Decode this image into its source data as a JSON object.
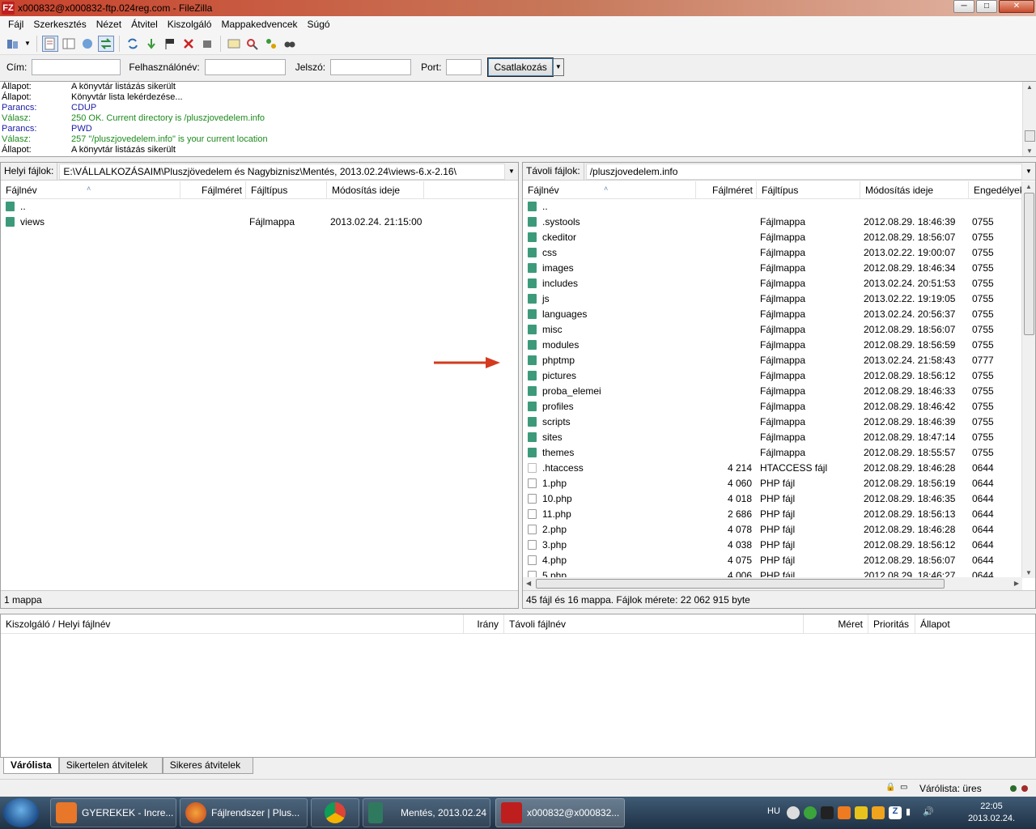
{
  "window": {
    "title": "x000832@x000832-ftp.024reg.com - FileZilla",
    "app_icon": "FZ"
  },
  "menu": [
    "Fájl",
    "Szerkesztés",
    "Nézet",
    "Átvitel",
    "Kiszolgáló",
    "Mappakedvencek",
    "Súgó"
  ],
  "quickconnect": {
    "host_label": "Cím:",
    "user_label": "Felhasználónév:",
    "pass_label": "Jelszó:",
    "port_label": "Port:",
    "host_value": "",
    "user_value": "",
    "pass_value": "",
    "port_value": "",
    "connect_label": "Csatlakozás"
  },
  "log": [
    {
      "kind": "status",
      "k": "Állapot:",
      "v": "A könyvtár listázás sikerült"
    },
    {
      "kind": "status",
      "k": "Állapot:",
      "v": "Könyvtár lista lekérdezése..."
    },
    {
      "kind": "cmd",
      "k": "Parancs:",
      "v": "CDUP"
    },
    {
      "kind": "resp",
      "k": "Válasz:",
      "v": "250 OK. Current directory is /pluszjovedelem.info"
    },
    {
      "kind": "cmd",
      "k": "Parancs:",
      "v": "PWD"
    },
    {
      "kind": "resp",
      "k": "Válasz:",
      "v": "257 \"/pluszjovedelem.info\" is your current location"
    },
    {
      "kind": "status",
      "k": "Állapot:",
      "v": "A könyvtár listázás sikerült"
    }
  ],
  "local": {
    "label": "Helyi fájlok:",
    "path": "E:\\VÁLLALKOZÁSAIM\\Pluszjövedelem és Nagybiznisz\\Mentés, 2013.02.24\\views-6.x-2.16\\",
    "headers": {
      "name": "Fájlnév",
      "size": "Fájlméret",
      "type": "Fájltípus",
      "modified": "Módosítás ideje"
    },
    "rows": [
      {
        "name": "..",
        "size": "",
        "type": "",
        "modified": "",
        "icon": "folder"
      },
      {
        "name": "views",
        "size": "",
        "type": "Fájlmappa",
        "modified": "2013.02.24. 21:15:00",
        "icon": "folder"
      }
    ],
    "status": "1 mappa"
  },
  "remote": {
    "label": "Távoli fájlok:",
    "path": "/pluszjovedelem.info",
    "headers": {
      "name": "Fájlnév",
      "size": "Fájlméret",
      "type": "Fájltípus",
      "modified": "Módosítás ideje",
      "perms": "Engedélyek"
    },
    "rows": [
      {
        "name": "..",
        "size": "",
        "type": "",
        "modified": "",
        "perms": "",
        "icon": "folder"
      },
      {
        "name": ".systools",
        "size": "",
        "type": "Fájlmappa",
        "modified": "2012.08.29. 18:46:39",
        "perms": "0755",
        "icon": "folder"
      },
      {
        "name": "ckeditor",
        "size": "",
        "type": "Fájlmappa",
        "modified": "2012.08.29. 18:56:07",
        "perms": "0755",
        "icon": "folder"
      },
      {
        "name": "css",
        "size": "",
        "type": "Fájlmappa",
        "modified": "2013.02.22. 19:00:07",
        "perms": "0755",
        "icon": "folder"
      },
      {
        "name": "images",
        "size": "",
        "type": "Fájlmappa",
        "modified": "2012.08.29. 18:46:34",
        "perms": "0755",
        "icon": "folder"
      },
      {
        "name": "includes",
        "size": "",
        "type": "Fájlmappa",
        "modified": "2013.02.24. 20:51:53",
        "perms": "0755",
        "icon": "folder"
      },
      {
        "name": "js",
        "size": "",
        "type": "Fájlmappa",
        "modified": "2013.02.22. 19:19:05",
        "perms": "0755",
        "icon": "folder"
      },
      {
        "name": "languages",
        "size": "",
        "type": "Fájlmappa",
        "modified": "2013.02.24. 20:56:37",
        "perms": "0755",
        "icon": "folder"
      },
      {
        "name": "misc",
        "size": "",
        "type": "Fájlmappa",
        "modified": "2012.08.29. 18:56:07",
        "perms": "0755",
        "icon": "folder"
      },
      {
        "name": "modules",
        "size": "",
        "type": "Fájlmappa",
        "modified": "2012.08.29. 18:56:59",
        "perms": "0755",
        "icon": "folder"
      },
      {
        "name": "phptmp",
        "size": "",
        "type": "Fájlmappa",
        "modified": "2013.02.24. 21:58:43",
        "perms": "0777",
        "icon": "folder"
      },
      {
        "name": "pictures",
        "size": "",
        "type": "Fájlmappa",
        "modified": "2012.08.29. 18:56:12",
        "perms": "0755",
        "icon": "folder"
      },
      {
        "name": "proba_elemei",
        "size": "",
        "type": "Fájlmappa",
        "modified": "2012.08.29. 18:46:33",
        "perms": "0755",
        "icon": "folder"
      },
      {
        "name": "profiles",
        "size": "",
        "type": "Fájlmappa",
        "modified": "2012.08.29. 18:46:42",
        "perms": "0755",
        "icon": "folder"
      },
      {
        "name": "scripts",
        "size": "",
        "type": "Fájlmappa",
        "modified": "2012.08.29. 18:46:39",
        "perms": "0755",
        "icon": "folder"
      },
      {
        "name": "sites",
        "size": "",
        "type": "Fájlmappa",
        "modified": "2012.08.29. 18:47:14",
        "perms": "0755",
        "icon": "folder"
      },
      {
        "name": "themes",
        "size": "",
        "type": "Fájlmappa",
        "modified": "2012.08.29. 18:55:57",
        "perms": "0755",
        "icon": "folder"
      },
      {
        "name": ".htaccess",
        "size": "4 214",
        "type": "HTACCESS fájl",
        "modified": "2012.08.29. 18:46:28",
        "perms": "0644",
        "icon": "file"
      },
      {
        "name": "1.php",
        "size": "4 060",
        "type": "PHP fájl",
        "modified": "2012.08.29. 18:56:19",
        "perms": "0644",
        "icon": "php"
      },
      {
        "name": "10.php",
        "size": "4 018",
        "type": "PHP fájl",
        "modified": "2012.08.29. 18:46:35",
        "perms": "0644",
        "icon": "php"
      },
      {
        "name": "11.php",
        "size": "2 686",
        "type": "PHP fájl",
        "modified": "2012.08.29. 18:56:13",
        "perms": "0644",
        "icon": "php"
      },
      {
        "name": "2.php",
        "size": "4 078",
        "type": "PHP fájl",
        "modified": "2012.08.29. 18:46:28",
        "perms": "0644",
        "icon": "php"
      },
      {
        "name": "3.php",
        "size": "4 038",
        "type": "PHP fájl",
        "modified": "2012.08.29. 18:56:12",
        "perms": "0644",
        "icon": "php"
      },
      {
        "name": "4.php",
        "size": "4 075",
        "type": "PHP fájl",
        "modified": "2012.08.29. 18:56:07",
        "perms": "0644",
        "icon": "php"
      },
      {
        "name": "5.php",
        "size": "4 006",
        "type": "PHP fájl",
        "modified": "2012.08.29. 18:46:27",
        "perms": "0644",
        "icon": "php"
      }
    ],
    "status": "45 fájl és 16 mappa. Fájlok mérete: 22 062 915 byte"
  },
  "queue": {
    "headers": {
      "local": "Kiszolgáló / Helyi fájlnév",
      "direction": "Irány",
      "remote": "Távoli fájlnév",
      "size": "Méret",
      "priority": "Prioritás",
      "status": "Állapot"
    },
    "tabs": [
      "Várólista",
      "Sikertelen átvitelek",
      "Sikeres átvitelek"
    ]
  },
  "statusbar": {
    "queue_text": "Várólista: üres"
  },
  "taskbar": {
    "tasks": [
      {
        "label": "GYEREKEK - Incre...",
        "color": "#e8772a"
      },
      {
        "label": "Fájlrendszer | Plus...",
        "color": "#e86a1c"
      },
      {
        "label": "",
        "color": "#4285f4"
      },
      {
        "label": "Mentés, 2013.02.24",
        "color": "#2f7a5f"
      },
      {
        "label": "x000832@x000832...",
        "color": "#bf1e1e"
      }
    ],
    "lang": "HU",
    "time": "22:05",
    "date": "2013.02.24."
  },
  "colors": {
    "folder": "#3c9a7a",
    "log_command": "#1a1aa6",
    "log_response": "#1e8a1e",
    "annotation_arrow": "#d33a1e"
  },
  "icons": [
    "site-manager-icon",
    "toggle-log-icon",
    "toggle-tree-icon",
    "refresh-icon",
    "process-queue-icon",
    "cancel-icon",
    "disconnect-icon",
    "reconnect-icon",
    "filter-icon",
    "compare-icon",
    "sync-browse-icon",
    "find-icon"
  ]
}
